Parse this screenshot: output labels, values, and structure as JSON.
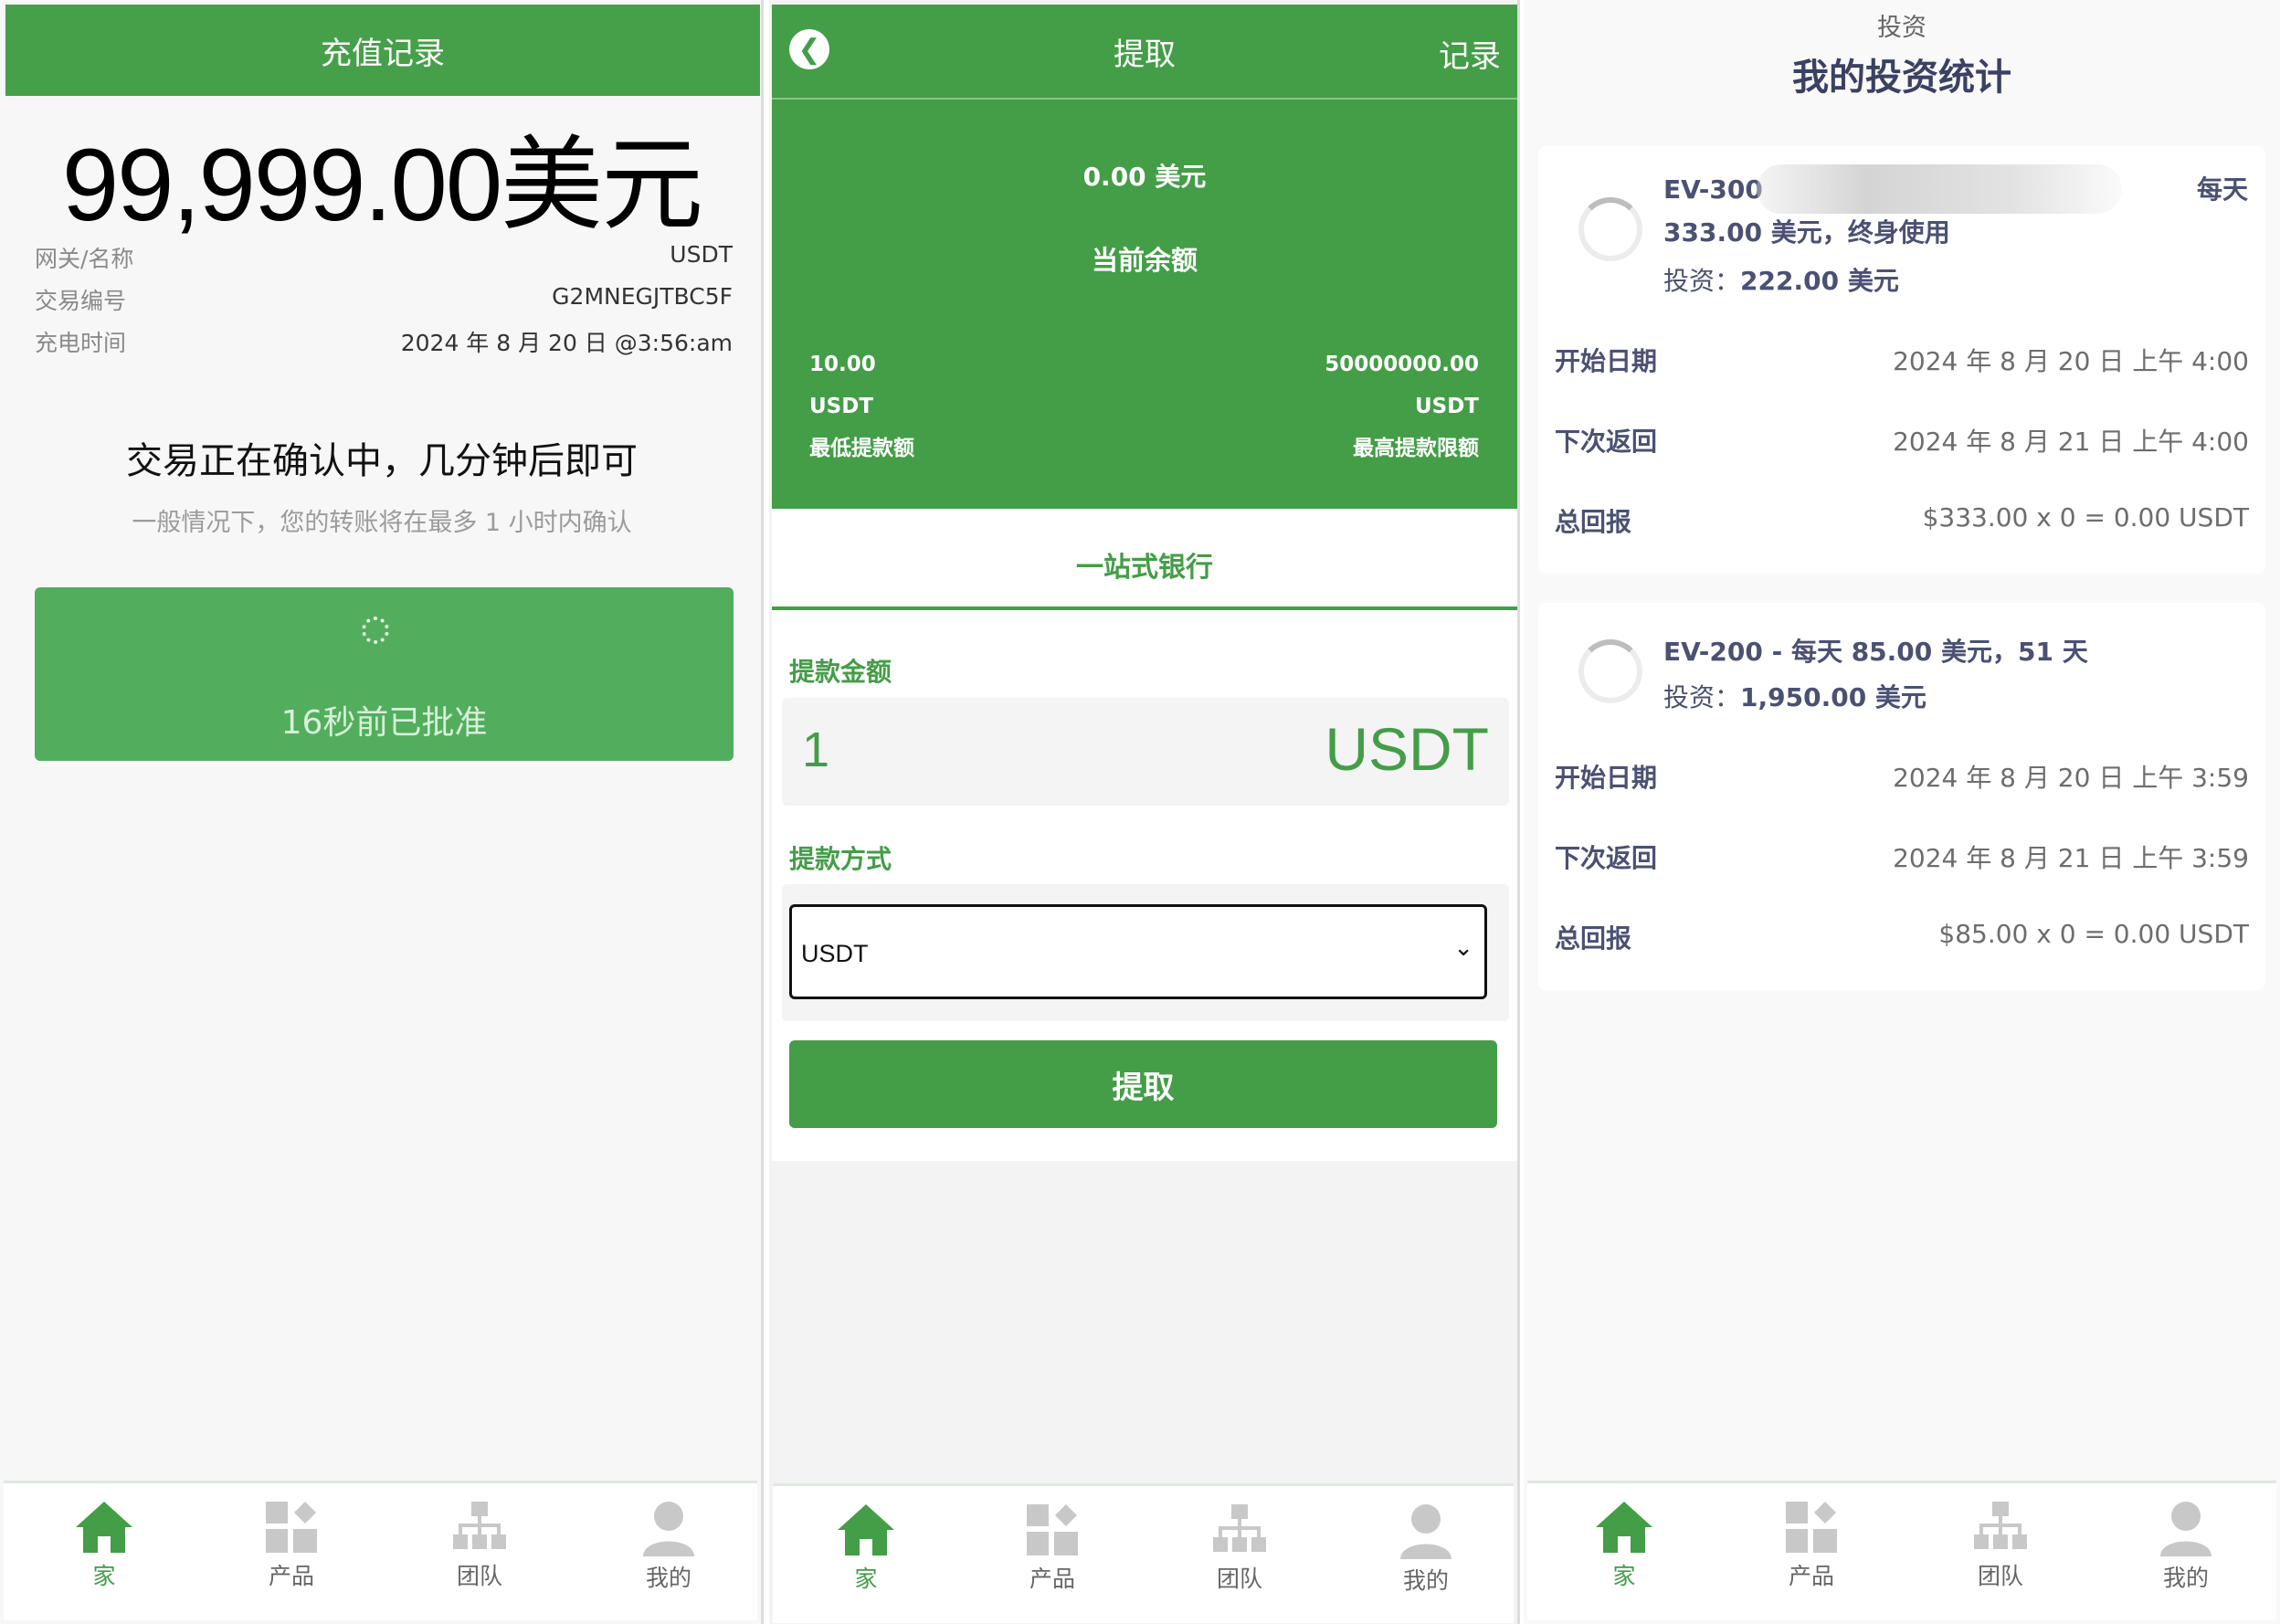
{
  "recharge": {
    "header_title": "充值记录",
    "amount": "99,999.00美元",
    "rows": [
      {
        "label": "网关/名称",
        "value": "USDT"
      },
      {
        "label": "交易编号",
        "value": "G2MNEGJTBC5F"
      },
      {
        "label": "充电时间",
        "value": "2024 年 8 月 20 日 @3:56:am"
      }
    ],
    "status_text": "交易正在确认中，几分钟后即可",
    "note": "一般情况下，您的转账将在最多 1 小时内确认",
    "approved_text": "16秒前已批准"
  },
  "withdraw": {
    "title": "提取",
    "record_link": "记录",
    "balance": "0.00 美元",
    "balance_label": "当前余额",
    "min_amount": "10.00",
    "min_unit": "USDT",
    "min_label": "最低提款额",
    "max_amount": "50000000.00",
    "max_unit": "USDT",
    "max_label": "最高提款限额",
    "tab": "一站式银行",
    "amount_label": "提款金额",
    "amount_value": "1",
    "amount_unit": "USDT",
    "method_label": "提款方式",
    "method_value": "USDT",
    "submit": "提取"
  },
  "investment": {
    "subtitle": "投资",
    "title": "我的投资统计",
    "plans": [
      {
        "name_line1_left": "EV-300",
        "name_line1_right": "每天",
        "name_line2": "333.00 美元，终身使用",
        "invest_label": "投资：",
        "invest_value": "222.00 美元",
        "start_label": "开始日期",
        "start_value": "2024 年 8 月 20 日 上午 4:00",
        "next_label": "下次返回",
        "next_value": "2024 年 8 月 21 日 上午 4:00",
        "total_label": "总回报",
        "total_value": "$333.00 x 0 = 0.00 USDT"
      },
      {
        "name_line1_left": "EV-200 - 每天 85.00 美元，51 天",
        "invest_label": "投资：",
        "invest_value": "1,950.00 美元",
        "start_label": "开始日期",
        "start_value": "2024 年 8 月 20 日 上午 3:59",
        "next_label": "下次返回",
        "next_value": "2024 年 8 月 21 日 上午 3:59",
        "total_label": "总回报",
        "total_value": "$85.00 x 0 = 0.00 USDT"
      }
    ]
  },
  "nav": {
    "home": "家",
    "products": "产品",
    "team": "团队",
    "mine": "我的"
  },
  "colors": {
    "brand_green": "#449d47",
    "inactive_icon": "#c8c8c8"
  },
  "icons": [
    "home-icon",
    "products-icon",
    "team-icon",
    "user-icon",
    "back-arrow-icon",
    "chevron-down-icon",
    "loading-spinner-icon",
    "progress-ring-icon"
  ]
}
